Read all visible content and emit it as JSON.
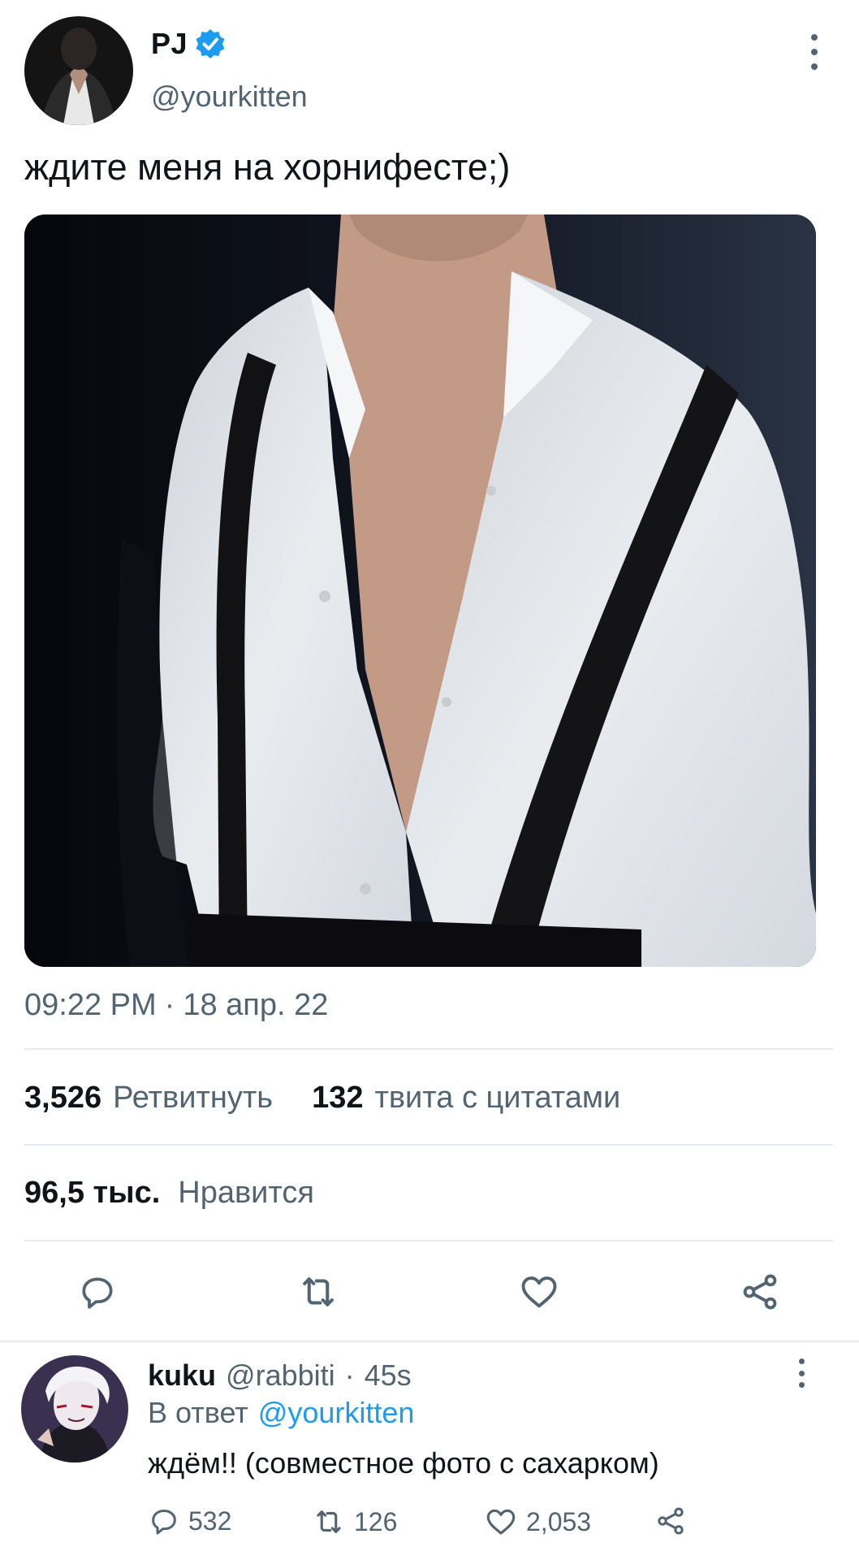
{
  "tweet": {
    "author_name": "PJ",
    "author_handle": "@yourkitten",
    "text": "ждите меня на хорнифесте;)",
    "time": "09:22 PM",
    "date_sep": "·",
    "date": "18 апр. 22",
    "stats": {
      "retweets_count": "3,526",
      "retweets_label": "Ретвитнуть",
      "quotes_count": "132",
      "quotes_label": "твита с цитатами",
      "likes_count": "96,5 тыс.",
      "likes_label": "Нравится"
    },
    "actions": [
      "reply-icon",
      "retweet-icon",
      "heart-icon",
      "share-icon"
    ],
    "verified_color": "#1d9bf0"
  },
  "reply": {
    "author_name": "kuku",
    "author_handle": "@rabbiti",
    "sep": "·",
    "age": "45s",
    "in_reply_prefix": "В ответ",
    "in_reply_handle": "@yourkitten",
    "text": "ждём!! (совместное фото с сахарком)",
    "counts": {
      "replies": "532",
      "retweets": "126",
      "likes": "2,053"
    }
  }
}
